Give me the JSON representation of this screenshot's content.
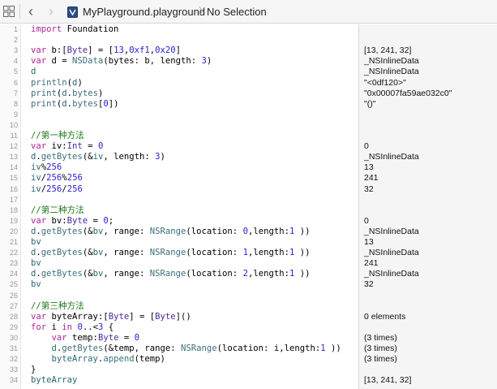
{
  "toolbar": {
    "grid_icon": "grid-icon",
    "back_icon": "chevron-left-icon",
    "forward_icon": "chevron-right-icon",
    "file_icon": "playground-file-icon",
    "filename": "MyPlayground.playground",
    "separator": "〉",
    "selection": "No Selection"
  },
  "lines": [
    {
      "num": "1",
      "tokens": [
        {
          "t": "import",
          "c": "kw"
        },
        {
          "t": " Foundation",
          "c": "pl"
        }
      ],
      "result": ""
    },
    {
      "num": "2",
      "tokens": [],
      "result": ""
    },
    {
      "num": "3",
      "tokens": [
        {
          "t": "var",
          "c": "kw"
        },
        {
          "t": " b:[",
          "c": "pl"
        },
        {
          "t": "Byte",
          "c": "ty"
        },
        {
          "t": "] = [",
          "c": "pl"
        },
        {
          "t": "13",
          "c": "nm"
        },
        {
          "t": ",",
          "c": "pl"
        },
        {
          "t": "0xf1",
          "c": "nm"
        },
        {
          "t": ",",
          "c": "pl"
        },
        {
          "t": "0x20",
          "c": "nm"
        },
        {
          "t": "]",
          "c": "pl"
        }
      ],
      "result": "[13, 241, 32]"
    },
    {
      "num": "4",
      "tokens": [
        {
          "t": "var",
          "c": "kw"
        },
        {
          "t": " d = ",
          "c": "pl"
        },
        {
          "t": "NSData",
          "c": "cl"
        },
        {
          "t": "(bytes: b, length: ",
          "c": "pl"
        },
        {
          "t": "3",
          "c": "nm"
        },
        {
          "t": ")",
          "c": "pl"
        }
      ],
      "result": "_NSInlineData"
    },
    {
      "num": "5",
      "tokens": [
        {
          "t": "d",
          "c": "id"
        }
      ],
      "result": "_NSInlineData"
    },
    {
      "num": "6",
      "tokens": [
        {
          "t": "println",
          "c": "cl"
        },
        {
          "t": "(",
          "c": "pl"
        },
        {
          "t": "d",
          "c": "id"
        },
        {
          "t": ")",
          "c": "pl"
        }
      ],
      "result": "\"<0df120>\""
    },
    {
      "num": "7",
      "tokens": [
        {
          "t": "print",
          "c": "cl"
        },
        {
          "t": "(",
          "c": "pl"
        },
        {
          "t": "d",
          "c": "id"
        },
        {
          "t": ".",
          "c": "pl"
        },
        {
          "t": "bytes",
          "c": "cl"
        },
        {
          "t": ")",
          "c": "pl"
        }
      ],
      "result": "\"0x00007fa59ae032c0\""
    },
    {
      "num": "8",
      "tokens": [
        {
          "t": "print",
          "c": "cl"
        },
        {
          "t": "(",
          "c": "pl"
        },
        {
          "t": "d",
          "c": "id"
        },
        {
          "t": ".",
          "c": "pl"
        },
        {
          "t": "bytes",
          "c": "cl"
        },
        {
          "t": "[",
          "c": "pl"
        },
        {
          "t": "0",
          "c": "nm"
        },
        {
          "t": "])",
          "c": "pl"
        }
      ],
      "result": "\"()\""
    },
    {
      "num": "9",
      "tokens": [],
      "result": ""
    },
    {
      "num": "10",
      "tokens": [],
      "result": ""
    },
    {
      "num": "11",
      "tokens": [
        {
          "t": "//第一种方法",
          "c": "cm"
        }
      ],
      "result": ""
    },
    {
      "num": "12",
      "tokens": [
        {
          "t": "var",
          "c": "kw"
        },
        {
          "t": " iv:",
          "c": "pl"
        },
        {
          "t": "Int",
          "c": "ty"
        },
        {
          "t": " = ",
          "c": "pl"
        },
        {
          "t": "0",
          "c": "nm"
        }
      ],
      "result": "0"
    },
    {
      "num": "13",
      "tokens": [
        {
          "t": "d",
          "c": "id"
        },
        {
          "t": ".",
          "c": "pl"
        },
        {
          "t": "getBytes",
          "c": "cl"
        },
        {
          "t": "(&",
          "c": "pl"
        },
        {
          "t": "iv",
          "c": "id"
        },
        {
          "t": ", length: ",
          "c": "pl"
        },
        {
          "t": "3",
          "c": "nm"
        },
        {
          "t": ")",
          "c": "pl"
        }
      ],
      "result": "_NSInlineData"
    },
    {
      "num": "14",
      "tokens": [
        {
          "t": "iv",
          "c": "id"
        },
        {
          "t": "%",
          "c": "pl"
        },
        {
          "t": "256",
          "c": "nm"
        }
      ],
      "result": "13"
    },
    {
      "num": "15",
      "tokens": [
        {
          "t": "iv",
          "c": "id"
        },
        {
          "t": "/",
          "c": "pl"
        },
        {
          "t": "256",
          "c": "nm"
        },
        {
          "t": "%",
          "c": "pl"
        },
        {
          "t": "256",
          "c": "nm"
        }
      ],
      "result": "241"
    },
    {
      "num": "16",
      "tokens": [
        {
          "t": "iv",
          "c": "id"
        },
        {
          "t": "/",
          "c": "pl"
        },
        {
          "t": "256",
          "c": "nm"
        },
        {
          "t": "/",
          "c": "pl"
        },
        {
          "t": "256",
          "c": "nm"
        }
      ],
      "result": "32"
    },
    {
      "num": "17",
      "tokens": [],
      "result": ""
    },
    {
      "num": "18",
      "tokens": [
        {
          "t": "//第二种方法",
          "c": "cm"
        }
      ],
      "result": ""
    },
    {
      "num": "19",
      "tokens": [
        {
          "t": "var",
          "c": "kw"
        },
        {
          "t": " bv:",
          "c": "pl"
        },
        {
          "t": "Byte",
          "c": "ty"
        },
        {
          "t": " = ",
          "c": "pl"
        },
        {
          "t": "0",
          "c": "nm"
        },
        {
          "t": ";",
          "c": "pl"
        }
      ],
      "result": "0"
    },
    {
      "num": "20",
      "tokens": [
        {
          "t": "d",
          "c": "id"
        },
        {
          "t": ".",
          "c": "pl"
        },
        {
          "t": "getBytes",
          "c": "cl"
        },
        {
          "t": "(&",
          "c": "pl"
        },
        {
          "t": "bv",
          "c": "id"
        },
        {
          "t": ", range: ",
          "c": "pl"
        },
        {
          "t": "NSRange",
          "c": "cl"
        },
        {
          "t": "(location: ",
          "c": "pl"
        },
        {
          "t": "0",
          "c": "nm"
        },
        {
          "t": ",length:",
          "c": "pl"
        },
        {
          "t": "1",
          "c": "nm"
        },
        {
          "t": " ))",
          "c": "pl"
        }
      ],
      "result": "_NSInlineData"
    },
    {
      "num": "21",
      "tokens": [
        {
          "t": "bv",
          "c": "id"
        }
      ],
      "result": "13"
    },
    {
      "num": "22",
      "tokens": [
        {
          "t": "d",
          "c": "id"
        },
        {
          "t": ".",
          "c": "pl"
        },
        {
          "t": "getBytes",
          "c": "cl"
        },
        {
          "t": "(&",
          "c": "pl"
        },
        {
          "t": "bv",
          "c": "id"
        },
        {
          "t": ", range: ",
          "c": "pl"
        },
        {
          "t": "NSRange",
          "c": "cl"
        },
        {
          "t": "(location: ",
          "c": "pl"
        },
        {
          "t": "1",
          "c": "nm"
        },
        {
          "t": ",length:",
          "c": "pl"
        },
        {
          "t": "1",
          "c": "nm"
        },
        {
          "t": " ))",
          "c": "pl"
        }
      ],
      "result": "_NSInlineData"
    },
    {
      "num": "23",
      "tokens": [
        {
          "t": "bv",
          "c": "id"
        }
      ],
      "result": "241"
    },
    {
      "num": "24",
      "tokens": [
        {
          "t": "d",
          "c": "id"
        },
        {
          "t": ".",
          "c": "pl"
        },
        {
          "t": "getBytes",
          "c": "cl"
        },
        {
          "t": "(&",
          "c": "pl"
        },
        {
          "t": "bv",
          "c": "id"
        },
        {
          "t": ", range: ",
          "c": "pl"
        },
        {
          "t": "NSRange",
          "c": "cl"
        },
        {
          "t": "(location: ",
          "c": "pl"
        },
        {
          "t": "2",
          "c": "nm"
        },
        {
          "t": ",length:",
          "c": "pl"
        },
        {
          "t": "1",
          "c": "nm"
        },
        {
          "t": " ))",
          "c": "pl"
        }
      ],
      "result": "_NSInlineData"
    },
    {
      "num": "25",
      "tokens": [
        {
          "t": "bv",
          "c": "id"
        }
      ],
      "result": "32"
    },
    {
      "num": "26",
      "tokens": [],
      "result": ""
    },
    {
      "num": "27",
      "tokens": [
        {
          "t": "//第三种方法",
          "c": "cm"
        }
      ],
      "result": ""
    },
    {
      "num": "28",
      "tokens": [
        {
          "t": "var",
          "c": "kw"
        },
        {
          "t": " byteArray:[",
          "c": "pl"
        },
        {
          "t": "Byte",
          "c": "ty"
        },
        {
          "t": "] = [",
          "c": "pl"
        },
        {
          "t": "Byte",
          "c": "ty"
        },
        {
          "t": "]()",
          "c": "pl"
        }
      ],
      "result": "0 elements"
    },
    {
      "num": "29",
      "tokens": [
        {
          "t": "for",
          "c": "kw"
        },
        {
          "t": " i ",
          "c": "pl"
        },
        {
          "t": "in",
          "c": "kw"
        },
        {
          "t": " ",
          "c": "pl"
        },
        {
          "t": "0",
          "c": "nm"
        },
        {
          "t": "..<",
          "c": "pl"
        },
        {
          "t": "3",
          "c": "nm"
        },
        {
          "t": " {",
          "c": "pl"
        }
      ],
      "result": ""
    },
    {
      "num": "30",
      "tokens": [
        {
          "t": "    var",
          "c": "kw"
        },
        {
          "t": " temp:",
          "c": "pl"
        },
        {
          "t": "Byte",
          "c": "ty"
        },
        {
          "t": " = ",
          "c": "pl"
        },
        {
          "t": "0",
          "c": "nm"
        }
      ],
      "result": "(3 times)"
    },
    {
      "num": "31",
      "tokens": [
        {
          "t": "    ",
          "c": "pl"
        },
        {
          "t": "d",
          "c": "id"
        },
        {
          "t": ".",
          "c": "pl"
        },
        {
          "t": "getBytes",
          "c": "cl"
        },
        {
          "t": "(&temp, range: ",
          "c": "pl"
        },
        {
          "t": "NSRange",
          "c": "cl"
        },
        {
          "t": "(location: i,length:",
          "c": "pl"
        },
        {
          "t": "1",
          "c": "nm"
        },
        {
          "t": " ))",
          "c": "pl"
        }
      ],
      "result": "(3 times)"
    },
    {
      "num": "32",
      "tokens": [
        {
          "t": "    ",
          "c": "pl"
        },
        {
          "t": "byteArray",
          "c": "id"
        },
        {
          "t": ".",
          "c": "pl"
        },
        {
          "t": "append",
          "c": "cl"
        },
        {
          "t": "(temp)",
          "c": "pl"
        }
      ],
      "result": "(3 times)"
    },
    {
      "num": "33",
      "tokens": [
        {
          "t": "}",
          "c": "pl"
        }
      ],
      "result": ""
    },
    {
      "num": "34",
      "tokens": [
        {
          "t": "byteArray",
          "c": "id"
        }
      ],
      "result": "[13, 241, 32]"
    }
  ],
  "colors": {
    "keyword": "#b0259b",
    "type": "#4a2a9c",
    "class_or_method": "#3c6f7c",
    "number": "#2b21d6",
    "comment": "#1f7a18",
    "identifier": "#2b6774"
  }
}
